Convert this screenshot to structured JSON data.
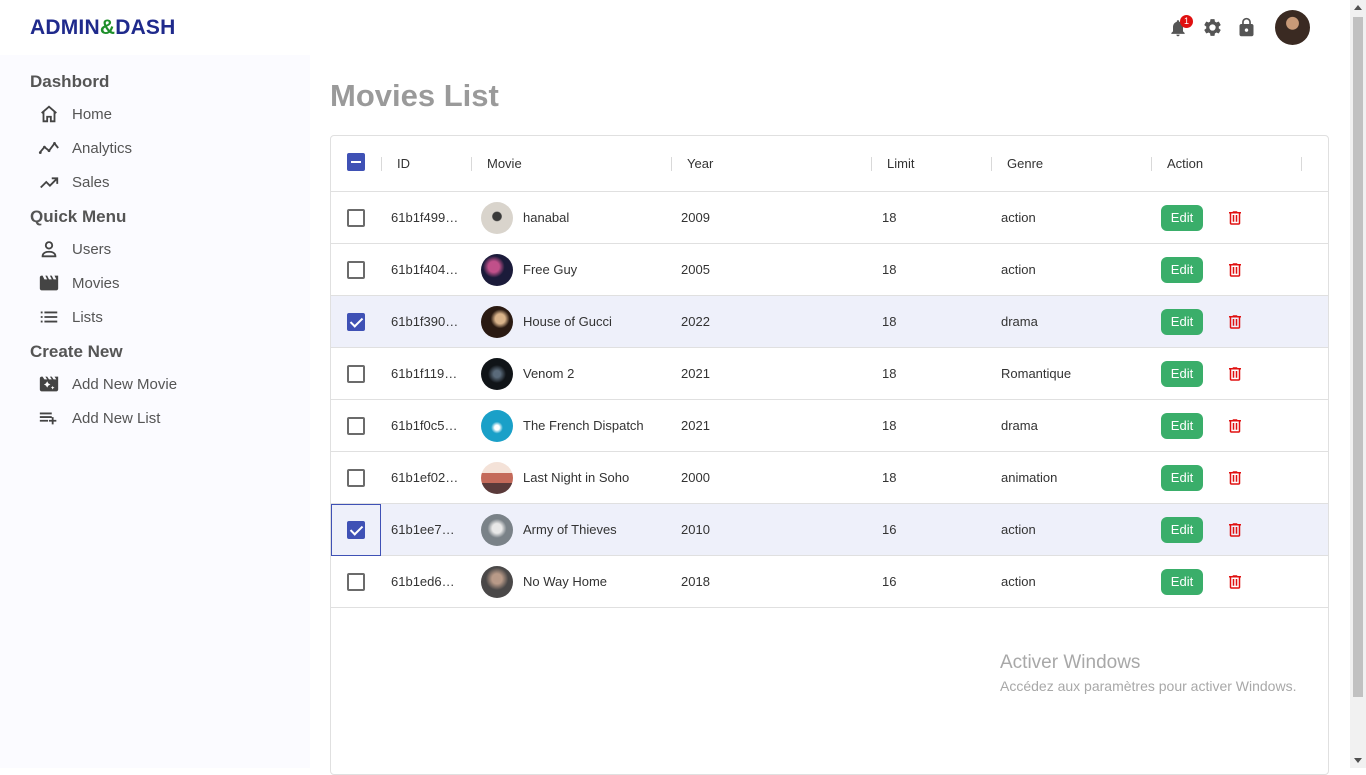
{
  "logo": {
    "part1": "ADMIN",
    "amp": "&",
    "part2": "DASH"
  },
  "topbar": {
    "notification_count": "1"
  },
  "sidebar": {
    "sections": [
      {
        "title": "Dashbord",
        "items": [
          "Home",
          "Analytics",
          "Sales"
        ]
      },
      {
        "title": "Quick Menu",
        "items": [
          "Users",
          "Movies",
          "Lists"
        ]
      },
      {
        "title": "Create New",
        "items": [
          "Add New Movie",
          "Add New List"
        ]
      }
    ]
  },
  "main": {
    "title": "Movies List"
  },
  "table": {
    "columns": [
      "ID",
      "Movie",
      "Year",
      "Limit",
      "Genre",
      "Action"
    ],
    "edit_label": "Edit",
    "rows": [
      {
        "id": "61b1f499…",
        "movie": "hanabal",
        "year": "2009",
        "limit": "18",
        "genre": "action",
        "selected": false
      },
      {
        "id": "61b1f404…",
        "movie": "Free Guy",
        "year": "2005",
        "limit": "18",
        "genre": "action",
        "selected": false
      },
      {
        "id": "61b1f390…",
        "movie": "House of Gucci",
        "year": "2022",
        "limit": "18",
        "genre": "drama",
        "selected": true
      },
      {
        "id": "61b1f119…",
        "movie": "Venom 2",
        "year": "2021",
        "limit": "18",
        "genre": "Romantique",
        "selected": false
      },
      {
        "id": "61b1f0c5…",
        "movie": "The French Dispatch",
        "year": "2021",
        "limit": "18",
        "genre": "drama",
        "selected": false
      },
      {
        "id": "61b1ef02…",
        "movie": "Last Night in Soho",
        "year": "2000",
        "limit": "18",
        "genre": "animation",
        "selected": false
      },
      {
        "id": "61b1ee7…",
        "movie": "Army of Thieves",
        "year": "2010",
        "limit": "16",
        "genre": "action",
        "selected": true
      },
      {
        "id": "61b1ed6…",
        "movie": "No Way Home",
        "year": "2018",
        "limit": "16",
        "genre": "action",
        "selected": false
      }
    ]
  },
  "watermark": {
    "line1": "Activer Windows",
    "line2": "Accédez aux paramètres pour activer Windows."
  },
  "colors": {
    "accent": "#3f51b5",
    "edit": "#3aae6a",
    "delete": "#e01010",
    "logo_blue": "#1f2a8c",
    "logo_green": "#1e8f2a"
  }
}
